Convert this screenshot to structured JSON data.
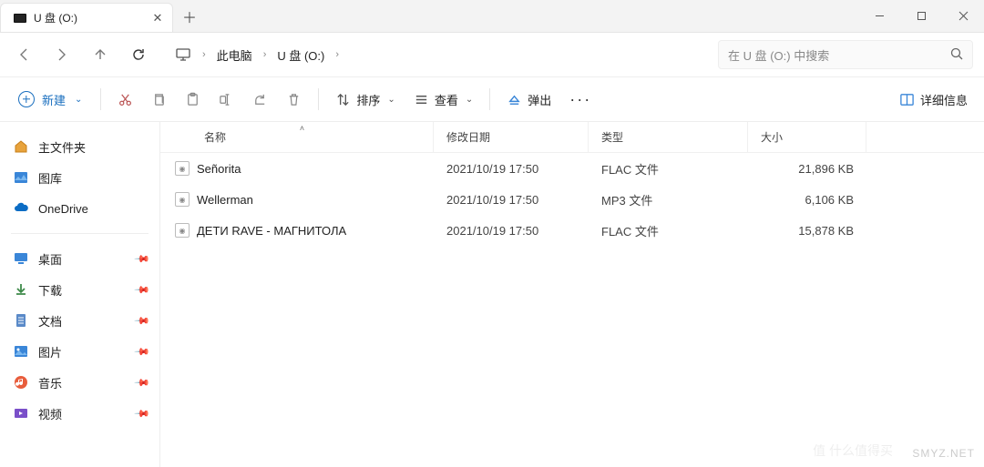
{
  "titlebar": {
    "tab_label": "U 盘 (O:)",
    "close": "✕",
    "newtab": "＋"
  },
  "nav": {
    "crumb1": "此电脑",
    "crumb2": "U 盘 (O:)"
  },
  "search": {
    "placeholder": "在 U 盘 (O:) 中搜索"
  },
  "toolbar": {
    "new_label": "新建",
    "sort_label": "排序",
    "view_label": "查看",
    "eject_label": "弹出",
    "details_label": "详细信息"
  },
  "sidebar": {
    "home": "主文件夹",
    "gallery": "图库",
    "onedrive": "OneDrive",
    "desktop": "桌面",
    "downloads": "下载",
    "documents": "文档",
    "pictures": "图片",
    "music": "音乐",
    "videos": "视频"
  },
  "columns": {
    "name": "名称",
    "date": "修改日期",
    "type": "类型",
    "size": "大小"
  },
  "files": [
    {
      "name": "Señorita",
      "date": "2021/10/19 17:50",
      "type": "FLAC 文件",
      "size": "21,896 KB"
    },
    {
      "name": "Wellerman",
      "date": "2021/10/19 17:50",
      "type": "MP3 文件",
      "size": "6,106 KB"
    },
    {
      "name": "ДЕТИ RAVE - МАГНИТОЛА",
      "date": "2021/10/19 17:50",
      "type": "FLAC 文件",
      "size": "15,878 KB"
    }
  ],
  "watermark": {
    "text1": "值 什么值得买",
    "text2": "SMYZ.NET"
  }
}
